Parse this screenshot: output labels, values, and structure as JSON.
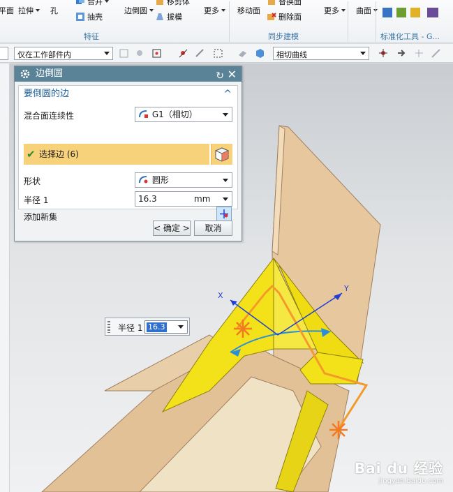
{
  "ribbon": {
    "items": {
      "face_partial": "平面",
      "extrude": "拉伸",
      "hole": "孔",
      "unite": "合并",
      "shell": "抽壳",
      "edge_blend": "边倒圆",
      "move_body": "移剪体",
      "draft": "拔模",
      "more1": "更多",
      "move_face": "移动面",
      "replace_face": "替换面",
      "delete_face": "删除面",
      "more2": "更多",
      "surface": "曲面"
    },
    "groups": {
      "feature": "特征",
      "sync_modeling": "同步建模",
      "standard_tools": "标准化工具 - G..."
    }
  },
  "toolbar": {
    "scope_value": "仅在工作部件内",
    "curve_rule_value": "相切曲线"
  },
  "dialog": {
    "title": "边倒圆",
    "section_title": "要倒圆的边",
    "continuity_label": "混合面连续性",
    "continuity_value": "G1（相切）",
    "select_edge_label": "选择边 (6)",
    "shape_label": "形状",
    "shape_value": "圆形",
    "radius_label": "半径 1",
    "radius_value": "16.3",
    "radius_unit": "mm",
    "add_set_label": "添加新集",
    "ok_label": "< 确定 >",
    "cancel_label": "取消"
  },
  "onscreen_input": {
    "label": "半径 1",
    "value": "16.3"
  },
  "triad": {
    "x_label": "X",
    "y_label": "Y"
  },
  "watermark": {
    "brand": "Bai du 经验",
    "url": "jingyan.baidu.com"
  },
  "colors": {
    "dialog_title_bg": "#5b8397",
    "selection_bar": "#f8d27a",
    "model_tan": "#e8c9a0",
    "blend_yellow": "#f2e21a",
    "handle_orange": "#f39a2a",
    "triad_blue": "#1f3fd6"
  }
}
